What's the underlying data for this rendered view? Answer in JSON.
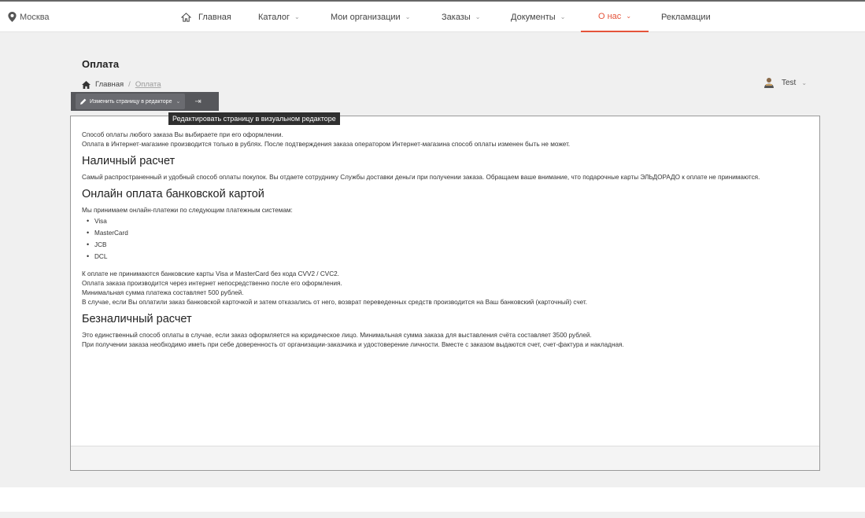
{
  "topbar": {
    "city": "Москва",
    "nav": [
      {
        "label": "Главная",
        "chevron": false,
        "active": false
      },
      {
        "label": "Каталог",
        "chevron": true,
        "active": false
      },
      {
        "label": "Мои организации",
        "chevron": true,
        "active": false
      },
      {
        "label": "Заказы",
        "chevron": true,
        "active": false
      },
      {
        "label": "Документы",
        "chevron": true,
        "active": false
      },
      {
        "label": "О нас",
        "chevron": true,
        "active": true
      },
      {
        "label": "Рекламации",
        "chevron": false,
        "active": false
      }
    ],
    "chevron_glyph": "⌄"
  },
  "page": {
    "title": "Оплата",
    "breadcrumb": {
      "home": "Главная",
      "separator": "/",
      "current": "Оплата"
    }
  },
  "user": {
    "name": "Test"
  },
  "editor": {
    "button_label": "Изменить страницу в редакторе",
    "pin_glyph": "⇥",
    "tooltip": "Редактировать страницу в визуальном редакторе"
  },
  "content": {
    "intro_1": "Способ оплаты любого заказа Вы выбираете при его оформлении.",
    "intro_2": "Оплата в Интернет-магазине производится только в рублях. После подтверждения заказа оператором Интернет-магазина способ оплаты изменен быть не может.",
    "cash": {
      "heading": "Наличный расчет",
      "text": "Самый распространенный и удобный способ оплаты покупок. Вы отдаете сотруднику Службы доставки деньги при получении заказа. Обращаем ваше внимание, что подарочные карты ЭЛЬДОРАДО к оплате не принимаются."
    },
    "card": {
      "heading": "Онлайн оплата банковской картой",
      "lead": "Мы принимаем онлайн-платежи по следующим платежным системам:",
      "systems": [
        "Visa",
        "MasterCard",
        "JCB",
        "DCL"
      ],
      "note_1": "К оплате не принимаются банковские карты Visa и MasterCard без кода CVV2 / CVC2.",
      "note_2": "Оплата заказа производится через интернет непосредственно после его оформления.",
      "note_3": "Минимальная сумма платежа составляет 500 рублей.",
      "note_4": "В случае, если Вы оплатили заказ банковской карточкой и затем отказались от него, возврат переведенных средств производится на Ваш банковский (карточный) счет."
    },
    "noncash": {
      "heading": "Безналичный расчет",
      "text_1": "Это единственный способ оплаты в случае, если заказ оформляется на юридическое лицо. Минимальная сумма заказа для выставления счёта составляет 3500 рублей.",
      "text_2": "При получении заказа необходимо иметь при себе доверенность от организации-заказчика и удостоверение личности. Вместе с заказом выдаются счет, счет-фактура и накладная."
    }
  },
  "colors": {
    "accent": "#e5533a",
    "editor_bar": "#56575b"
  },
  "icons": {
    "city": "map-pin-icon",
    "home": "home-icon",
    "user": "user-icon",
    "edit": "pencil-icon",
    "pin": "pin-icon"
  }
}
